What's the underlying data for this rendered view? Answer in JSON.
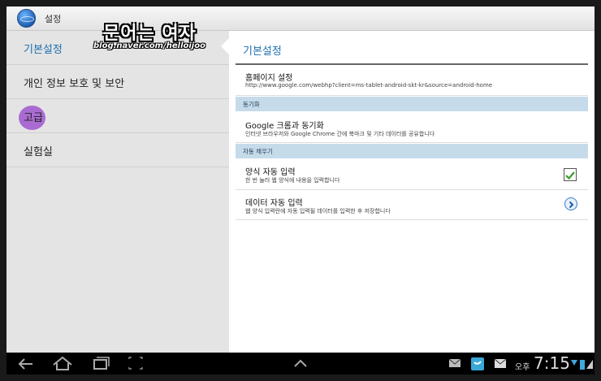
{
  "window": {
    "title": "설정"
  },
  "watermark": {
    "title": "문어는 여자",
    "url": "blog.naver.com/helloijoo"
  },
  "left_nav": {
    "items": [
      {
        "label": "기본설정",
        "selected": true
      },
      {
        "label": "개인 정보 보호 및 보안"
      },
      {
        "label": "고급",
        "highlighted": true
      },
      {
        "label": "실험실"
      }
    ]
  },
  "detail": {
    "header": "기본설정",
    "homepage": {
      "title": "홈페이지 설정",
      "summary": "http://www.google.com/webhp?client=ms-tablet-android-skt-kr&source=android-home"
    },
    "sync_category": "동기화",
    "sync": {
      "title": "Google 크롬과 동기화",
      "summary": "인터넷 브라우저와 Google Chrome 간에 북마크 및 기타 데이터를 공유합니다"
    },
    "autofill_category": "자동 채우기",
    "form_autofill": {
      "title": "양식 자동 입력",
      "summary": "한 번 눌러 웹 양식에 내용을 입력합니다",
      "checked": true
    },
    "data_autofill": {
      "title": "데이터 자동 입력",
      "summary": "웹 양식 입력란에 자동 입력될 데이터를 입력한 후 저장합니다"
    }
  },
  "navbar": {
    "ampm": "오후",
    "time": "7:15"
  },
  "colors": {
    "accent": "#1b6fb0",
    "category_bg": "#c6dbea",
    "check": "#3a9a2a",
    "highlight": "#a96bd1"
  }
}
